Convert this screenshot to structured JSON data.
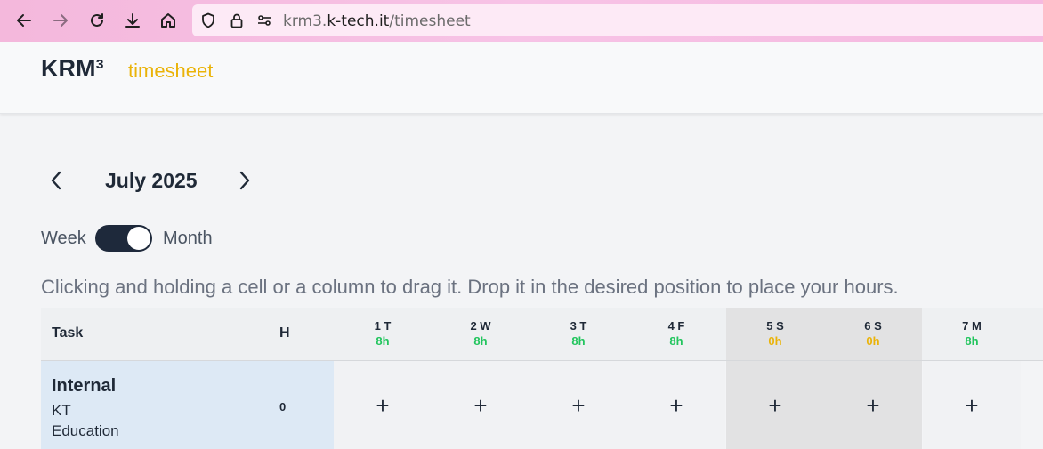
{
  "browser": {
    "url_prefix": "krm3.",
    "url_host": "k-tech.it",
    "url_path": "/timesheet"
  },
  "header": {
    "brand": "KRM³",
    "section": "timesheet"
  },
  "calendar": {
    "month_label": "July 2025",
    "toggle_left": "Week",
    "toggle_right": "Month",
    "toggle_state": "Month"
  },
  "hint": "Clicking and holding a cell or a column to drag it. Drop it in the desired position to place your hours.",
  "table": {
    "col_task": "Task",
    "col_hours": "H",
    "days": [
      {
        "label": "1 T",
        "hours": "8h",
        "weekend": false
      },
      {
        "label": "2 W",
        "hours": "8h",
        "weekend": false
      },
      {
        "label": "3 T",
        "hours": "8h",
        "weekend": false
      },
      {
        "label": "4 F",
        "hours": "8h",
        "weekend": false
      },
      {
        "label": "5 S",
        "hours": "0h",
        "weekend": true
      },
      {
        "label": "6 S",
        "hours": "0h",
        "weekend": true
      },
      {
        "label": "7 M",
        "hours": "8h",
        "weekend": false
      }
    ],
    "rows": [
      {
        "project": "Internal",
        "client": "KT",
        "category": "Education",
        "total": "0"
      }
    ],
    "add_symbol": "+"
  },
  "colors": {
    "workday_hours": "#22c55e",
    "weekend_hours": "#eab308",
    "accent": "#eab308"
  }
}
